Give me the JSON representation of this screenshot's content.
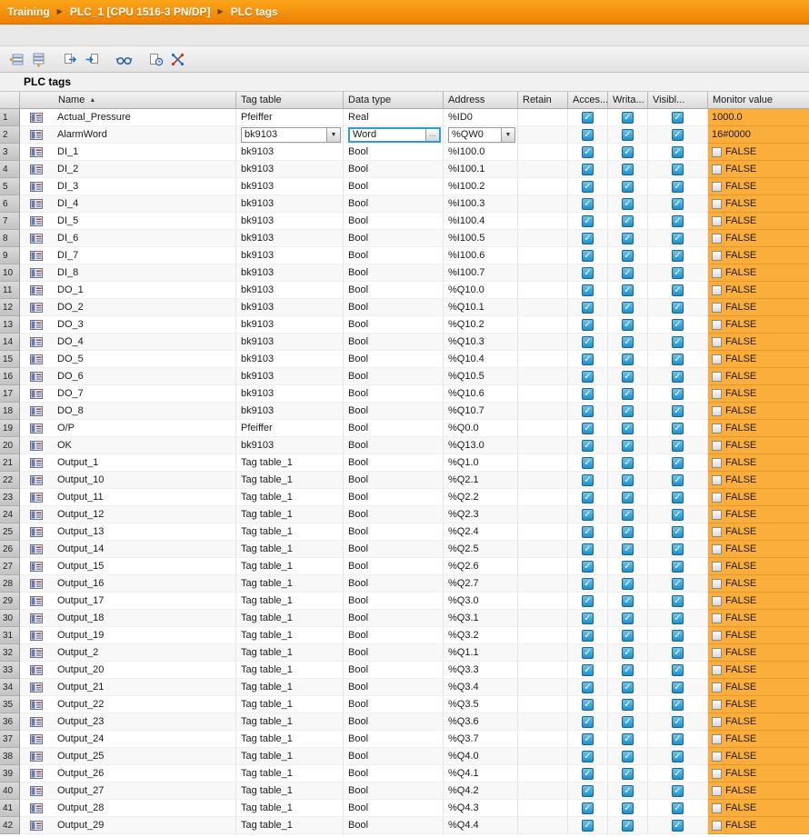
{
  "breadcrumb": {
    "items": [
      "Training",
      "PLC_1 [CPU 1516-3 PN/DP]",
      "PLC tags"
    ],
    "separator": "▶"
  },
  "toolbar": {
    "buttons": [
      "insert-row",
      "add-row",
      "export",
      "import",
      "monitor-all",
      "snapshot",
      "cross-reference"
    ]
  },
  "section_title": "PLC tags",
  "icons": {
    "check": "✓",
    "dropdown": "▼",
    "sort_asc": "▲",
    "browse": "…"
  },
  "colors": {
    "breadcrumb_top": "#FAA61A",
    "breadcrumb_bottom": "#EE7F01",
    "monitor_bg": "#FBAE3C",
    "selection_blue": "#2E9BD6"
  },
  "table": {
    "headers": {
      "name": "Name",
      "tag_table": "Tag table",
      "data_type": "Data type",
      "address": "Address",
      "retain": "Retain",
      "accessible": "Acces...",
      "writable": "Writa...",
      "visible": "Visibl...",
      "monitor": "Monitor value"
    },
    "editing_row": "2",
    "columns_key": [
      "num",
      "name",
      "tag_table",
      "data_type",
      "address",
      "retain",
      "accessible",
      "writable",
      "visible",
      "monitor_value",
      "monitor_has_bool_icon"
    ],
    "rows": [
      [
        "1",
        "Actual_Pressure",
        "Pfeiffer",
        "Real",
        "%ID0",
        false,
        true,
        true,
        true,
        "1000.0",
        false
      ],
      [
        "2",
        "AlarmWord",
        "bk9103",
        "Word",
        "%QW0",
        false,
        true,
        true,
        true,
        "16#0000",
        false
      ],
      [
        "3",
        "DI_1",
        "bk9103",
        "Bool",
        "%I100.0",
        false,
        true,
        true,
        true,
        "FALSE",
        true
      ],
      [
        "4",
        "DI_2",
        "bk9103",
        "Bool",
        "%I100.1",
        false,
        true,
        true,
        true,
        "FALSE",
        true
      ],
      [
        "5",
        "DI_3",
        "bk9103",
        "Bool",
        "%I100.2",
        false,
        true,
        true,
        true,
        "FALSE",
        true
      ],
      [
        "6",
        "DI_4",
        "bk9103",
        "Bool",
        "%I100.3",
        false,
        true,
        true,
        true,
        "FALSE",
        true
      ],
      [
        "7",
        "DI_5",
        "bk9103",
        "Bool",
        "%I100.4",
        false,
        true,
        true,
        true,
        "FALSE",
        true
      ],
      [
        "8",
        "DI_6",
        "bk9103",
        "Bool",
        "%I100.5",
        false,
        true,
        true,
        true,
        "FALSE",
        true
      ],
      [
        "9",
        "DI_7",
        "bk9103",
        "Bool",
        "%I100.6",
        false,
        true,
        true,
        true,
        "FALSE",
        true
      ],
      [
        "10",
        "DI_8",
        "bk9103",
        "Bool",
        "%I100.7",
        false,
        true,
        true,
        true,
        "FALSE",
        true
      ],
      [
        "11",
        "DO_1",
        "bk9103",
        "Bool",
        "%Q10.0",
        false,
        true,
        true,
        true,
        "FALSE",
        true
      ],
      [
        "12",
        "DO_2",
        "bk9103",
        "Bool",
        "%Q10.1",
        false,
        true,
        true,
        true,
        "FALSE",
        true
      ],
      [
        "13",
        "DO_3",
        "bk9103",
        "Bool",
        "%Q10.2",
        false,
        true,
        true,
        true,
        "FALSE",
        true
      ],
      [
        "14",
        "DO_4",
        "bk9103",
        "Bool",
        "%Q10.3",
        false,
        true,
        true,
        true,
        "FALSE",
        true
      ],
      [
        "15",
        "DO_5",
        "bk9103",
        "Bool",
        "%Q10.4",
        false,
        true,
        true,
        true,
        "FALSE",
        true
      ],
      [
        "16",
        "DO_6",
        "bk9103",
        "Bool",
        "%Q10.5",
        false,
        true,
        true,
        true,
        "FALSE",
        true
      ],
      [
        "17",
        "DO_7",
        "bk9103",
        "Bool",
        "%Q10.6",
        false,
        true,
        true,
        true,
        "FALSE",
        true
      ],
      [
        "18",
        "DO_8",
        "bk9103",
        "Bool",
        "%Q10.7",
        false,
        true,
        true,
        true,
        "FALSE",
        true
      ],
      [
        "19",
        "O/P",
        "Pfeiffer",
        "Bool",
        "%Q0.0",
        false,
        true,
        true,
        true,
        "FALSE",
        true
      ],
      [
        "20",
        "OK",
        "bk9103",
        "Bool",
        "%Q13.0",
        false,
        true,
        true,
        true,
        "FALSE",
        true
      ],
      [
        "21",
        "Output_1",
        "Tag table_1",
        "Bool",
        "%Q1.0",
        false,
        true,
        true,
        true,
        "FALSE",
        true
      ],
      [
        "22",
        "Output_10",
        "Tag table_1",
        "Bool",
        "%Q2.1",
        false,
        true,
        true,
        true,
        "FALSE",
        true
      ],
      [
        "23",
        "Output_11",
        "Tag table_1",
        "Bool",
        "%Q2.2",
        false,
        true,
        true,
        true,
        "FALSE",
        true
      ],
      [
        "24",
        "Output_12",
        "Tag table_1",
        "Bool",
        "%Q2.3",
        false,
        true,
        true,
        true,
        "FALSE",
        true
      ],
      [
        "25",
        "Output_13",
        "Tag table_1",
        "Bool",
        "%Q2.4",
        false,
        true,
        true,
        true,
        "FALSE",
        true
      ],
      [
        "26",
        "Output_14",
        "Tag table_1",
        "Bool",
        "%Q2.5",
        false,
        true,
        true,
        true,
        "FALSE",
        true
      ],
      [
        "27",
        "Output_15",
        "Tag table_1",
        "Bool",
        "%Q2.6",
        false,
        true,
        true,
        true,
        "FALSE",
        true
      ],
      [
        "28",
        "Output_16",
        "Tag table_1",
        "Bool",
        "%Q2.7",
        false,
        true,
        true,
        true,
        "FALSE",
        true
      ],
      [
        "29",
        "Output_17",
        "Tag table_1",
        "Bool",
        "%Q3.0",
        false,
        true,
        true,
        true,
        "FALSE",
        true
      ],
      [
        "30",
        "Output_18",
        "Tag table_1",
        "Bool",
        "%Q3.1",
        false,
        true,
        true,
        true,
        "FALSE",
        true
      ],
      [
        "31",
        "Output_19",
        "Tag table_1",
        "Bool",
        "%Q3.2",
        false,
        true,
        true,
        true,
        "FALSE",
        true
      ],
      [
        "32",
        "Output_2",
        "Tag table_1",
        "Bool",
        "%Q1.1",
        false,
        true,
        true,
        true,
        "FALSE",
        true
      ],
      [
        "33",
        "Output_20",
        "Tag table_1",
        "Bool",
        "%Q3.3",
        false,
        true,
        true,
        true,
        "FALSE",
        true
      ],
      [
        "34",
        "Output_21",
        "Tag table_1",
        "Bool",
        "%Q3.4",
        false,
        true,
        true,
        true,
        "FALSE",
        true
      ],
      [
        "35",
        "Output_22",
        "Tag table_1",
        "Bool",
        "%Q3.5",
        false,
        true,
        true,
        true,
        "FALSE",
        true
      ],
      [
        "36",
        "Output_23",
        "Tag table_1",
        "Bool",
        "%Q3.6",
        false,
        true,
        true,
        true,
        "FALSE",
        true
      ],
      [
        "37",
        "Output_24",
        "Tag table_1",
        "Bool",
        "%Q3.7",
        false,
        true,
        true,
        true,
        "FALSE",
        true
      ],
      [
        "38",
        "Output_25",
        "Tag table_1",
        "Bool",
        "%Q4.0",
        false,
        true,
        true,
        true,
        "FALSE",
        true
      ],
      [
        "39",
        "Output_26",
        "Tag table_1",
        "Bool",
        "%Q4.1",
        false,
        true,
        true,
        true,
        "FALSE",
        true
      ],
      [
        "40",
        "Output_27",
        "Tag table_1",
        "Bool",
        "%Q4.2",
        false,
        true,
        true,
        true,
        "FALSE",
        true
      ],
      [
        "41",
        "Output_28",
        "Tag table_1",
        "Bool",
        "%Q4.3",
        false,
        true,
        true,
        true,
        "FALSE",
        true
      ],
      [
        "42",
        "Output_29",
        "Tag table_1",
        "Bool",
        "%Q4.4",
        false,
        true,
        true,
        true,
        "FALSE",
        true
      ]
    ]
  }
}
